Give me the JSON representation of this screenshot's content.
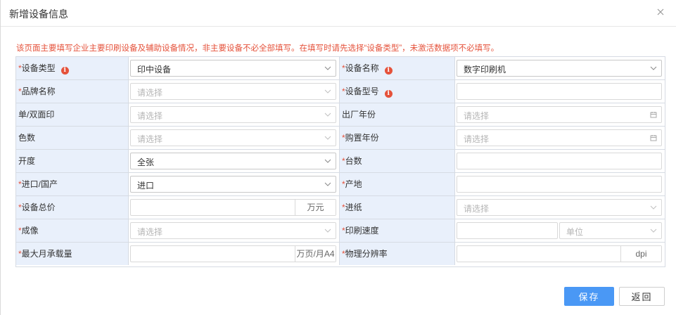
{
  "dialog": {
    "title": "新增设备信息",
    "notice": "该页面主要填写企业主要印刷设备及辅助设备情况，非主要设备不必全部填写。在填写时请先选择“设备类型”，未激活数据项不必填写。"
  },
  "rows": [
    {
      "left": {
        "label": "设备类型",
        "required": true,
        "info": true,
        "value": "印中设备"
      },
      "right": {
        "label": "设备名称",
        "required": true,
        "info": true,
        "value": "数字印刷机"
      }
    },
    {
      "left": {
        "label": "品牌名称",
        "required": true,
        "placeholder": "请选择"
      },
      "right": {
        "label": "设备型号",
        "required": true,
        "info": true,
        "value": ""
      }
    },
    {
      "left": {
        "label": "单/双面印",
        "placeholder": "请选择"
      },
      "right": {
        "label": "出厂年份",
        "placeholder": "请选择"
      }
    },
    {
      "left": {
        "label": "色数",
        "placeholder": "请选择"
      },
      "right": {
        "label": "购置年份",
        "required": true,
        "placeholder": "请选择"
      }
    },
    {
      "left": {
        "label": "开度",
        "value": "全张"
      },
      "right": {
        "label": "台数",
        "required": true,
        "value": ""
      }
    },
    {
      "left": {
        "label": "进口/国产",
        "required": true,
        "value": "进口"
      },
      "right": {
        "label": "产地",
        "required": true,
        "value": ""
      }
    },
    {
      "left": {
        "label": "设备总价",
        "required": true,
        "value": "",
        "suffix": "万元"
      },
      "right": {
        "label": "进纸",
        "required": true,
        "placeholder": "请选择"
      }
    },
    {
      "left": {
        "label": "成像",
        "required": true,
        "placeholder": "请选择"
      },
      "right": {
        "label": "印刷速度",
        "required": true,
        "value": "",
        "unit_placeholder": "单位"
      }
    },
    {
      "left": {
        "label": "最大月承载量",
        "required": true,
        "value": "",
        "suffix": "万页/月A4"
      },
      "right": {
        "label": "物理分辨率",
        "required": true,
        "value": "",
        "suffix": "dpi"
      }
    }
  ],
  "required_mark": "*",
  "info_glyph": "i",
  "buttons": {
    "save": "保存",
    "back": "返回"
  },
  "colors": {
    "accent": "#4a98f5",
    "notice": "#e5523b",
    "label_bg": "#e9f0fb"
  }
}
